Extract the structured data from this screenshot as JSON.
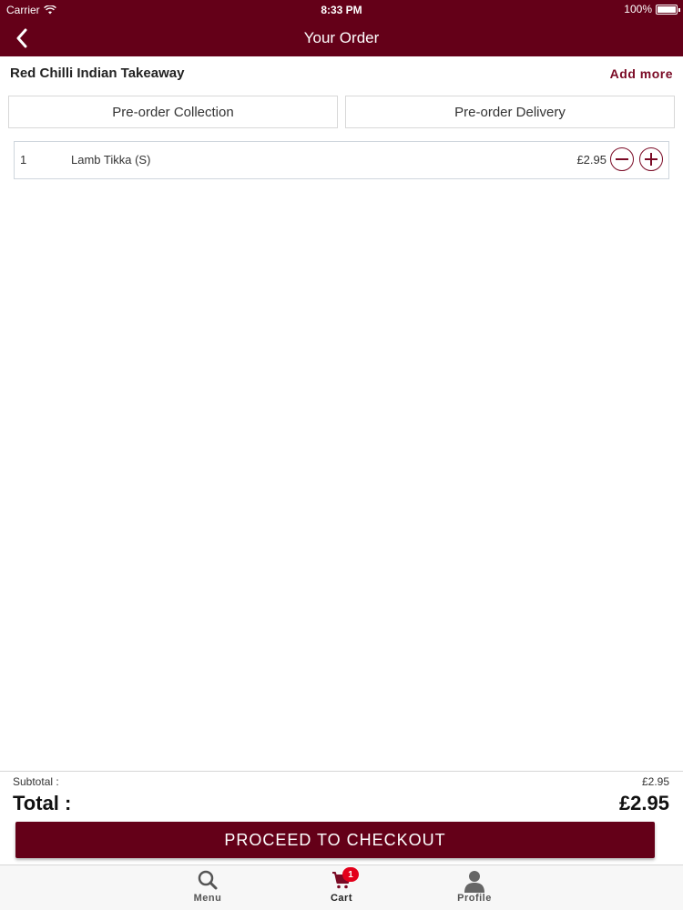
{
  "status_bar": {
    "carrier": "Carrier",
    "time": "8:33 PM",
    "battery": "100%"
  },
  "header": {
    "title": "Your Order",
    "back_icon": "chevron-left-icon"
  },
  "restaurant": {
    "name": "Red Chilli Indian Takeaway",
    "add_more_label": "Add more"
  },
  "order_type": {
    "collection_label": "Pre-order Collection",
    "delivery_label": "Pre-order Delivery"
  },
  "items": [
    {
      "qty": "1",
      "name": "Lamb Tikka (S)",
      "price": "£2.95"
    }
  ],
  "totals": {
    "subtotal_label": "Subtotal :",
    "subtotal_value": "£2.95",
    "total_label": "Total :",
    "total_value": "£2.95"
  },
  "checkout": {
    "label": "PROCEED TO CHECKOUT"
  },
  "tabbar": {
    "menu_label": "Menu",
    "cart_label": "Cart",
    "cart_badge": "1",
    "profile_label": "Profile"
  },
  "colors": {
    "brand": "#640018",
    "accent": "#7a0a25",
    "badge": "#e3001b"
  }
}
